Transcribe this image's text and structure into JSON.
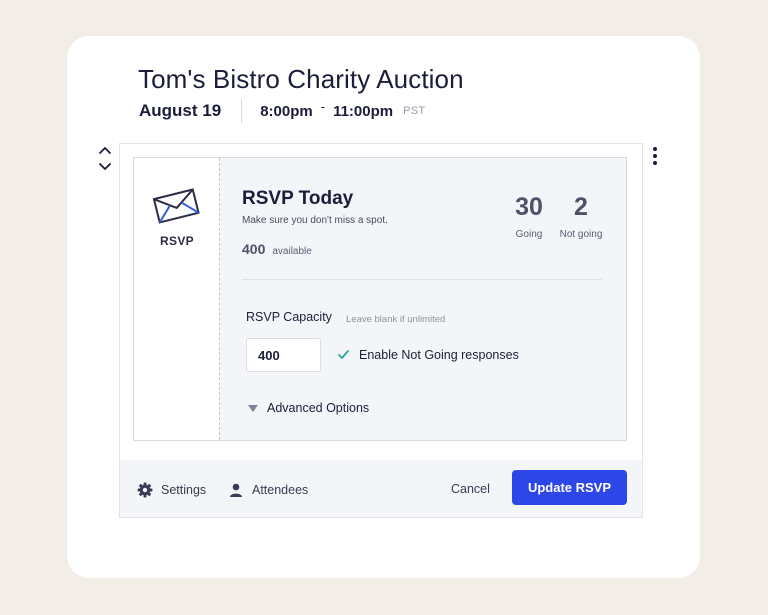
{
  "event": {
    "title": "Tom's Bistro Charity Auction",
    "date": "August 19",
    "start_time": "8:00pm",
    "time_separator": "-",
    "end_time": "11:00pm",
    "timezone": "PST"
  },
  "rsvp": {
    "icon": "envelope-icon",
    "label": "RSVP",
    "title": "RSVP Today",
    "subtitle": "Make sure you don't miss a spot.",
    "available_count": "400",
    "available_label": "available",
    "going_count": "30",
    "going_label": "Going",
    "not_going_count": "2",
    "not_going_label": "Not going"
  },
  "form": {
    "capacity_label": "RSVP Capacity",
    "capacity_hint": "Leave blank if unlimited",
    "capacity_value": "400",
    "not_going_checkbox_label": "Enable Not Going responses",
    "not_going_checked": true,
    "advanced_label": "Advanced Options"
  },
  "footer": {
    "settings_label": "Settings",
    "settings_icon": "gear-icon",
    "attendees_label": "Attendees",
    "attendees_icon": "person-icon",
    "cancel_label": "Cancel",
    "update_label": "Update RSVP"
  },
  "colors": {
    "accent": "#2d46e8",
    "check": "#2aa7a0",
    "background": "#f2ede7"
  }
}
